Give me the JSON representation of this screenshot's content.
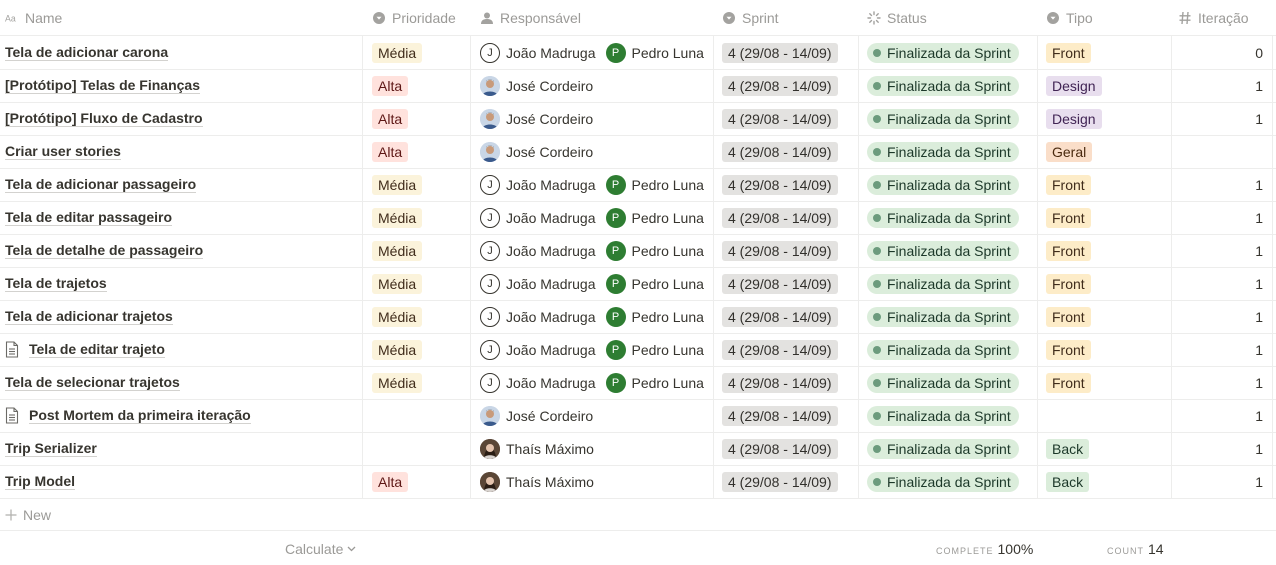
{
  "columns": {
    "name": "Name",
    "prioridade": "Prioridade",
    "responsavel": "Responsável",
    "sprint": "Sprint",
    "status": "Status",
    "tipo": "Tipo",
    "iteracao": "Iteração"
  },
  "column_icons": {
    "name": "text-icon",
    "prioridade": "select-icon",
    "responsavel": "person-icon",
    "sprint": "select-icon",
    "status": "status-icon",
    "tipo": "select-icon",
    "iteracao": "number-icon"
  },
  "people": {
    "joao": {
      "initial": "J",
      "name": "João Madruga"
    },
    "pedro": {
      "initial": "P",
      "name": "Pedro Luna"
    },
    "jose": {
      "name": "José Cordeiro"
    },
    "thais": {
      "name": "Thaís Máximo"
    }
  },
  "rows": [
    {
      "name": "Tela de adicionar carona",
      "icon": false,
      "prioridade": "Média",
      "resp": [
        "joao",
        "pedro"
      ],
      "sprint": "4 (29/08 - 14/09)",
      "status": "Finalizada da Sprint",
      "tipo": "Front",
      "iteracao": "0"
    },
    {
      "name": "[Protótipo] Telas de Finanças",
      "icon": false,
      "prioridade": "Alta",
      "resp": [
        "jose"
      ],
      "sprint": "4 (29/08 - 14/09)",
      "status": "Finalizada da Sprint",
      "tipo": "Design",
      "iteracao": "1"
    },
    {
      "name": "[Protótipo] Fluxo de Cadastro",
      "icon": false,
      "prioridade": "Alta",
      "resp": [
        "jose"
      ],
      "sprint": "4 (29/08 - 14/09)",
      "status": "Finalizada da Sprint",
      "tipo": "Design",
      "iteracao": "1"
    },
    {
      "name": "Criar user stories",
      "icon": false,
      "prioridade": "Alta",
      "resp": [
        "jose"
      ],
      "sprint": "4 (29/08 - 14/09)",
      "status": "Finalizada da Sprint",
      "tipo": "Geral",
      "iteracao": ""
    },
    {
      "name": "Tela de adicionar passageiro",
      "icon": false,
      "prioridade": "Média",
      "resp": [
        "joao",
        "pedro"
      ],
      "sprint": "4 (29/08 - 14/09)",
      "status": "Finalizada da Sprint",
      "tipo": "Front",
      "iteracao": "1"
    },
    {
      "name": "Tela de editar passageiro",
      "icon": false,
      "prioridade": "Média",
      "resp": [
        "joao",
        "pedro"
      ],
      "sprint": "4 (29/08 - 14/09)",
      "status": "Finalizada da Sprint",
      "tipo": "Front",
      "iteracao": "1"
    },
    {
      "name": "Tela de detalhe de passageiro",
      "icon": false,
      "prioridade": "Média",
      "resp": [
        "joao",
        "pedro"
      ],
      "sprint": "4 (29/08 - 14/09)",
      "status": "Finalizada da Sprint",
      "tipo": "Front",
      "iteracao": "1"
    },
    {
      "name": "Tela de trajetos",
      "icon": false,
      "prioridade": "Média",
      "resp": [
        "joao",
        "pedro"
      ],
      "sprint": "4 (29/08 - 14/09)",
      "status": "Finalizada da Sprint",
      "tipo": "Front",
      "iteracao": "1"
    },
    {
      "name": "Tela de adicionar trajetos",
      "icon": false,
      "prioridade": "Média",
      "resp": [
        "joao",
        "pedro"
      ],
      "sprint": "4 (29/08 - 14/09)",
      "status": "Finalizada da Sprint",
      "tipo": "Front",
      "iteracao": "1"
    },
    {
      "name": "Tela de editar trajeto",
      "icon": true,
      "prioridade": "Média",
      "resp": [
        "joao",
        "pedro"
      ],
      "sprint": "4 (29/08 - 14/09)",
      "status": "Finalizada da Sprint",
      "tipo": "Front",
      "iteracao": "1"
    },
    {
      "name": "Tela de selecionar trajetos",
      "icon": false,
      "prioridade": "Média",
      "resp": [
        "joao",
        "pedro"
      ],
      "sprint": "4 (29/08 - 14/09)",
      "status": "Finalizada da Sprint",
      "tipo": "Front",
      "iteracao": "1"
    },
    {
      "name": "Post Mortem da primeira iteração",
      "icon": true,
      "prioridade": "",
      "resp": [
        "jose"
      ],
      "sprint": "4 (29/08 - 14/09)",
      "status": "Finalizada da Sprint",
      "tipo": "",
      "iteracao": "1"
    },
    {
      "name": "Trip Serializer",
      "icon": false,
      "prioridade": "",
      "resp": [
        "thais"
      ],
      "sprint": "4 (29/08 - 14/09)",
      "status": "Finalizada da Sprint",
      "tipo": "Back",
      "iteracao": "1"
    },
    {
      "name": "Trip Model",
      "icon": false,
      "prioridade": "Alta",
      "resp": [
        "thais"
      ],
      "sprint": "4 (29/08 - 14/09)",
      "status": "Finalizada da Sprint",
      "tipo": "Back",
      "iteracao": "1"
    }
  ],
  "new_label": "New",
  "footer": {
    "calculate_label": "Calculate",
    "complete_label": "COMPLETE",
    "complete_value": "100%",
    "count_label": "COUNT",
    "count_value": "14"
  },
  "colors": {
    "status_green": "#dbeddb",
    "avatar_green": "#2e7d32"
  }
}
